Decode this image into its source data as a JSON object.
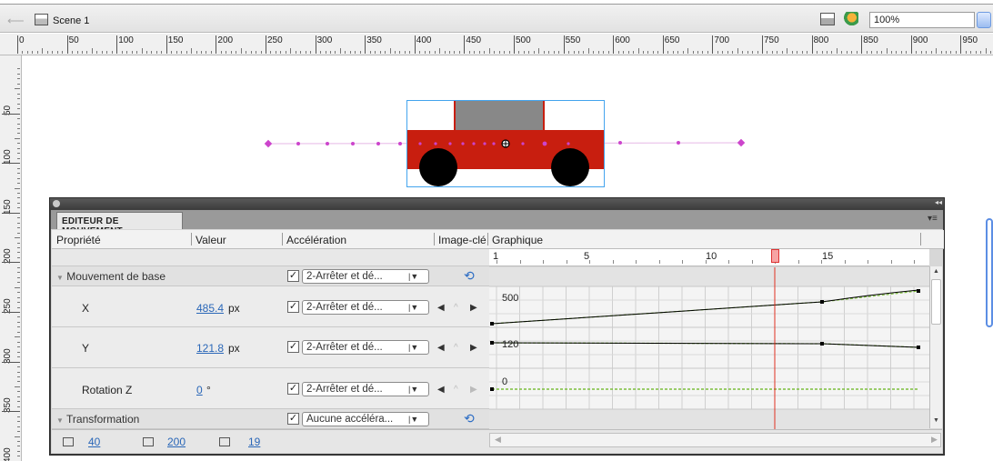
{
  "toolbar": {
    "scene": "Scene 1",
    "zoom": "100%"
  },
  "ruler": {
    "h_labels": [
      "0",
      "50",
      "100",
      "150",
      "200",
      "250",
      "300",
      "350",
      "400",
      "450",
      "500",
      "550",
      "600",
      "650",
      "700",
      "750",
      "800",
      "850",
      "900",
      "950"
    ],
    "v_labels": [
      "50",
      "100",
      "150",
      "200",
      "250",
      "300",
      "350",
      "400"
    ]
  },
  "panel": {
    "tab": "EDITEUR DE MOUVEMENT",
    "headers": {
      "prop": "Propriété",
      "val": "Valeur",
      "accel": "Accélération",
      "key": "Image-clé",
      "graph": "Graphique"
    },
    "frame_labels": [
      "1",
      "5",
      "10",
      "15"
    ],
    "sections": {
      "base": "Mouvement de base",
      "transform": "Transformation"
    },
    "rows": [
      {
        "label": "X",
        "value": "485.4",
        "unit": "px",
        "ease": "2-Arrêter et dé...",
        "graph": "500"
      },
      {
        "label": "Y",
        "value": "121.8",
        "unit": "px",
        "ease": "2-Arrêter et dé...",
        "graph": "120"
      },
      {
        "label": "Rotation Z",
        "value": "0",
        "unit": "°",
        "ease": "2-Arrêter et dé...",
        "graph": "0"
      }
    ],
    "base_ease": "2-Arrêter et dé...",
    "transform_ease": "Aucune accéléra...",
    "footer": {
      "a": "40",
      "b": "200",
      "c": "19"
    }
  },
  "colors": {
    "car_body": "#c81e0f",
    "window": "#888888",
    "path": "#cc44cc",
    "playhead": "#e03020"
  }
}
